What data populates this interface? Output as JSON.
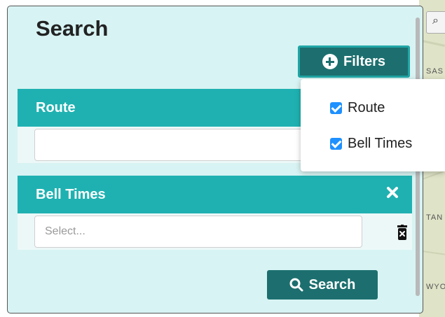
{
  "panel": {
    "title": "Search"
  },
  "filters_button": {
    "label": "Filters",
    "icon": "plus-circle-icon"
  },
  "filters_menu": {
    "items": [
      {
        "label": "Route",
        "checked": true
      },
      {
        "label": "Bell Times",
        "checked": true
      }
    ]
  },
  "route_section": {
    "title": "Route",
    "input_value": "",
    "input_placeholder": ""
  },
  "bell_times_section": {
    "title": "Bell Times",
    "select_placeholder": "Select..."
  },
  "search_button": {
    "label": "Search",
    "icon": "search-icon"
  },
  "map": {
    "labels": [
      "SAS",
      "TAN",
      "WYO"
    ]
  },
  "colors": {
    "panel_bg": "#d8f3f3",
    "section_header": "#1fb1b1",
    "button_dark": "#1d6f6f",
    "button_border": "#21a6a6",
    "checkbox": "#1e90ff"
  }
}
